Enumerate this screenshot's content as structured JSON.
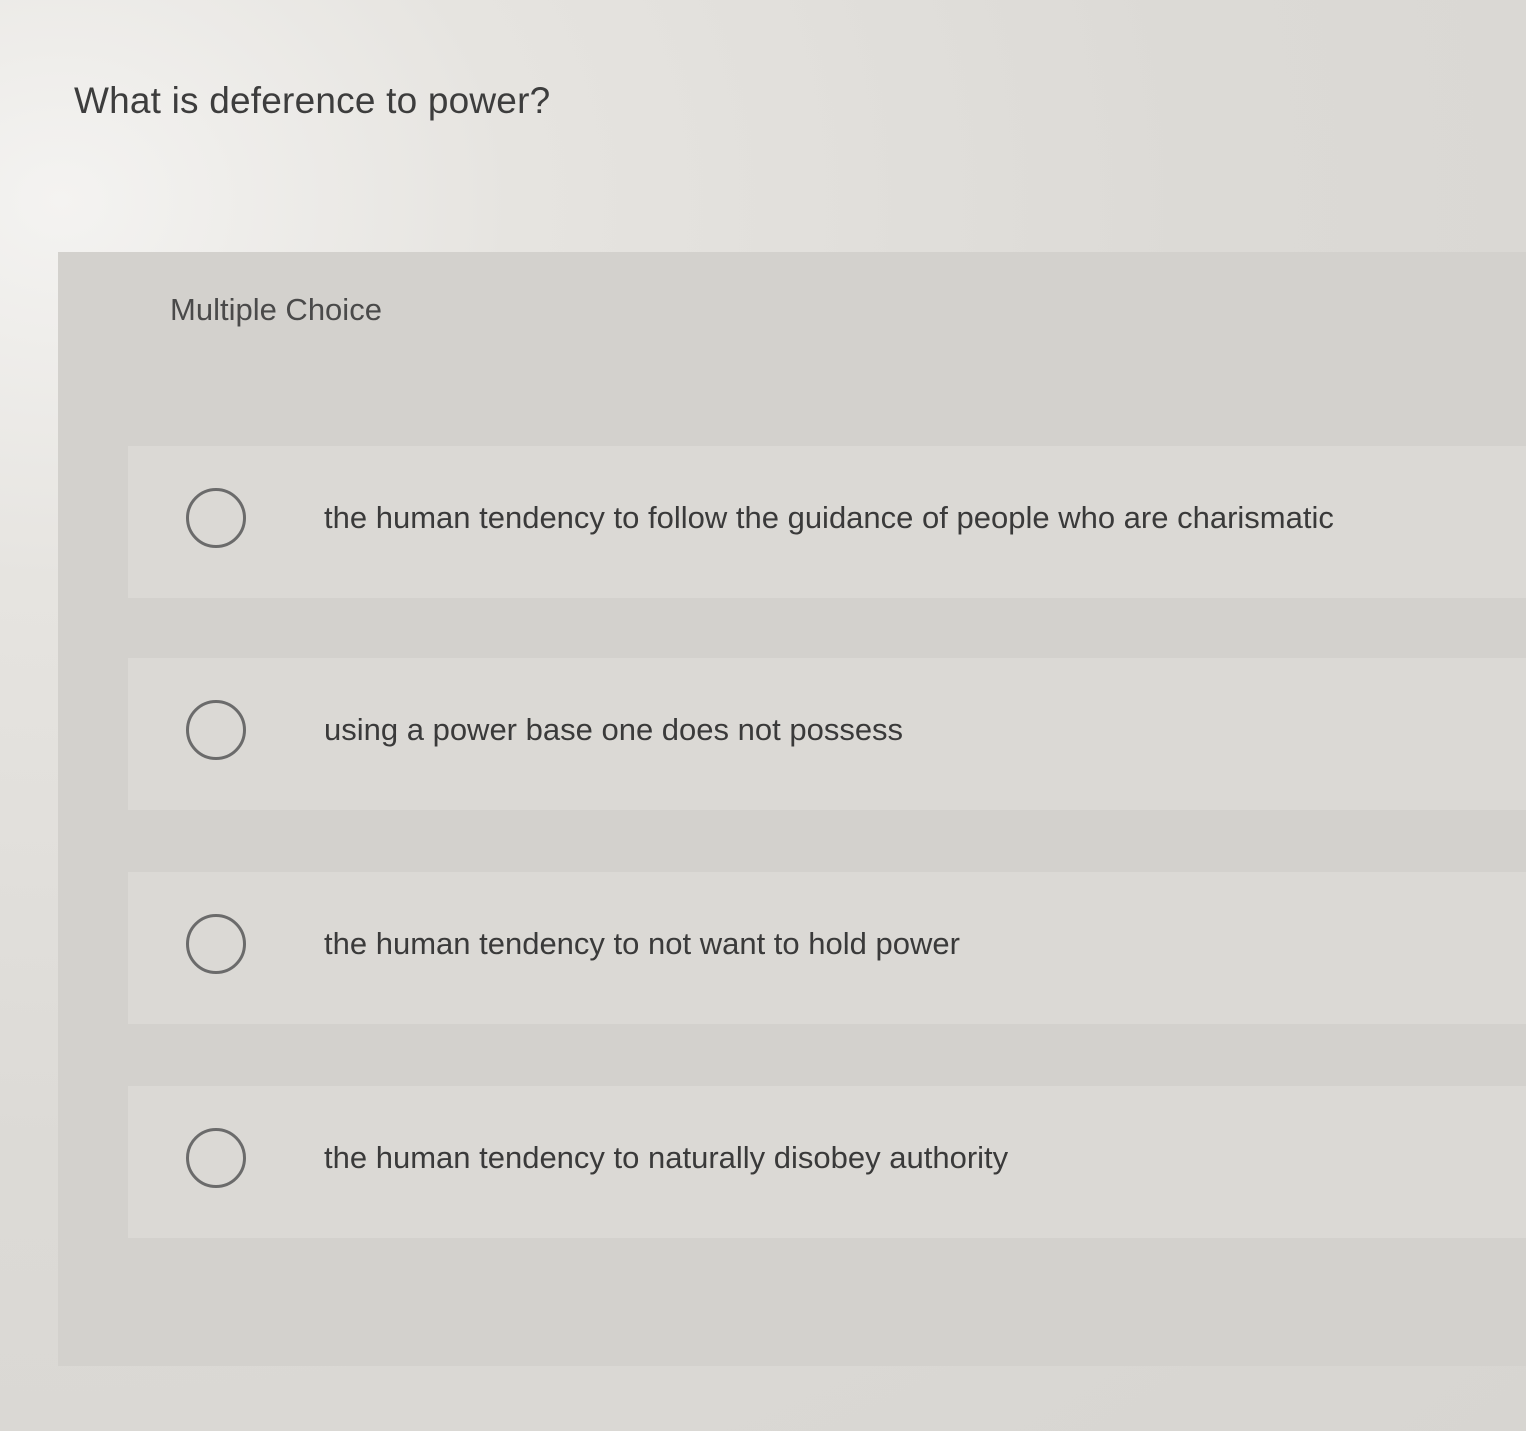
{
  "question": {
    "text": "What is deference to power?"
  },
  "question_type": "Multiple Choice",
  "choices": [
    {
      "label": "the human tendency to follow the guidance of people who are charismatic",
      "selected": false
    },
    {
      "label": "using a power base one does not possess",
      "selected": false
    },
    {
      "label": "the human tendency to not want to hold power",
      "selected": false
    },
    {
      "label": "the human tendency to naturally disobey authority",
      "selected": false
    }
  ],
  "colors": {
    "background": "#dcdad6",
    "panel": "#d3d1cd",
    "choice_row": "#dbd9d5",
    "text": "#3a3a3a",
    "radio_border": "#6b6b6b"
  }
}
